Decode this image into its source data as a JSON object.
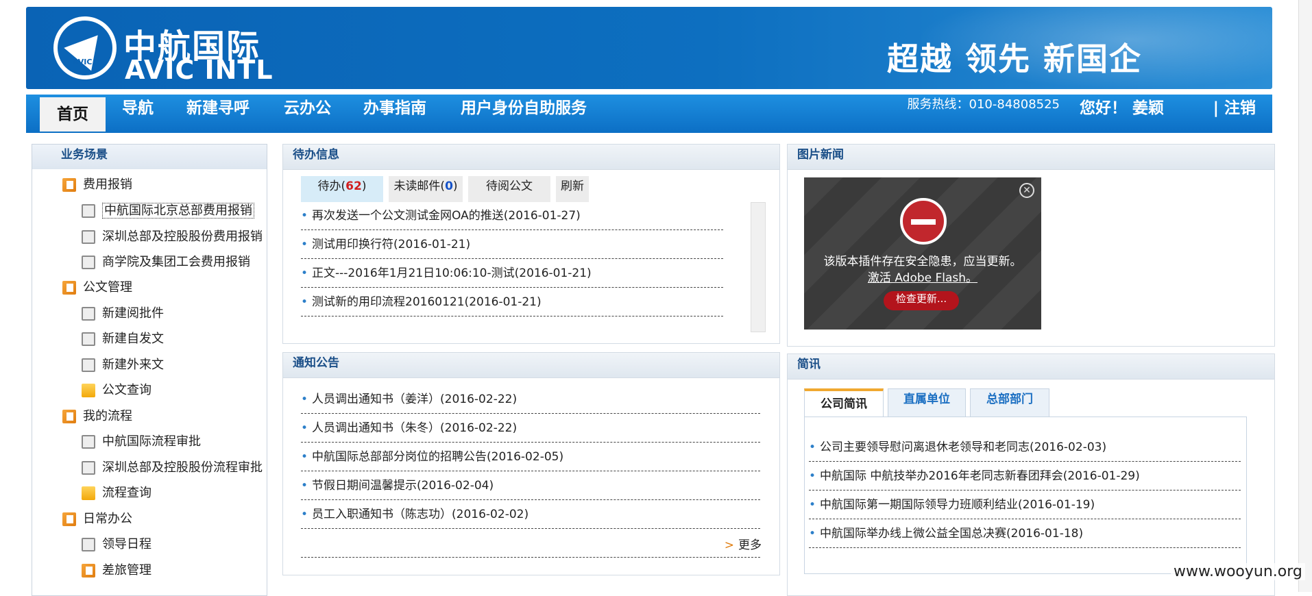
{
  "banner": {
    "logo_cn": "中航国际",
    "logo_en": "AVIC INTL",
    "logo_badge": "AVIC",
    "slogan": "超越 领先 新国企"
  },
  "nav": {
    "items": [
      "首页",
      "导航",
      "新建寻呼",
      "云办公",
      "办事指南",
      "用户身份自助服务"
    ],
    "hotline": "服务热线：010-84808525",
    "greeting": "您好！ 姜颖",
    "logout": "| 注销"
  },
  "sidebar": {
    "title": "业务场景",
    "rows": [
      {
        "label": "费用报销",
        "icon": "category-icon"
      },
      {
        "label": "中航国际北京总部费用报销",
        "icon": "document-icon"
      },
      {
        "label": "深圳总部及控股股份费用报销",
        "icon": "document-icon"
      },
      {
        "label": "商学院及集团工会费用报销",
        "icon": "document-icon"
      },
      {
        "label": "公文管理",
        "icon": "category-icon"
      },
      {
        "label": "新建阅批件",
        "icon": "document-icon"
      },
      {
        "label": "新建自发文",
        "icon": "document-icon"
      },
      {
        "label": "新建外来文",
        "icon": "document-icon"
      },
      {
        "label": "公文查询",
        "icon": "folder-icon"
      },
      {
        "label": "我的流程",
        "icon": "category-icon"
      },
      {
        "label": "中航国际流程审批",
        "icon": "document-icon"
      },
      {
        "label": "深圳总部及控股股份流程审批",
        "icon": "document-icon"
      },
      {
        "label": "流程查询",
        "icon": "folder-icon"
      },
      {
        "label": "日常办公",
        "icon": "category-icon"
      },
      {
        "label": "领导日程",
        "icon": "document-icon"
      },
      {
        "label": "差旅管理",
        "icon": "category-icon"
      }
    ]
  },
  "todo": {
    "title": "待办信息",
    "tab_todo_label": "待办(",
    "tab_todo_count": "62",
    "tab_close": ")",
    "tab_mail_label": "未读邮件(",
    "tab_mail_count": "0",
    "tab_read": "待阅公文",
    "tab_refresh": "刷新",
    "items": [
      "再次发送一个公文测试金网OA的推送(2016-01-27)",
      "测试用印换行符(2016-01-21)",
      "正文---2016年1月21日10:06:10-测试(2016-01-21)",
      "测试新的用印流程20160121(2016-01-21)"
    ]
  },
  "notice": {
    "title": "通知公告",
    "items": [
      "人员调出通知书（姜洋）(2016-02-22)",
      "人员调出通知书（朱冬）(2016-02-22)",
      "中航国际总部部分岗位的招聘公告(2016-02-05)",
      "节假日期间温馨提示(2016-02-04)",
      "员工入职通知书（陈志功）(2016-02-02)"
    ],
    "more": "更多"
  },
  "photo_news": {
    "title": "图片新闻",
    "flash_message": "该版本插件存在安全隐患，应当更新。",
    "flash_link": "激活 Adobe Flash。",
    "flash_button": "检查更新..."
  },
  "brief": {
    "title": "简讯",
    "tabs": [
      "公司简讯",
      "直属单位",
      "总部部门"
    ],
    "items": [
      "公司主要领导慰问离退休老领导和老同志(2016-02-03)",
      "中航国际 中航技举办2016年老同志新春团拜会(2016-01-29)",
      "中航国际第一期国际领导力班顺利结业(2016-01-19)",
      "中航国际举办线上微公益全国总决赛(2016-01-18)"
    ]
  },
  "watermark": "www.wooyun.org"
}
